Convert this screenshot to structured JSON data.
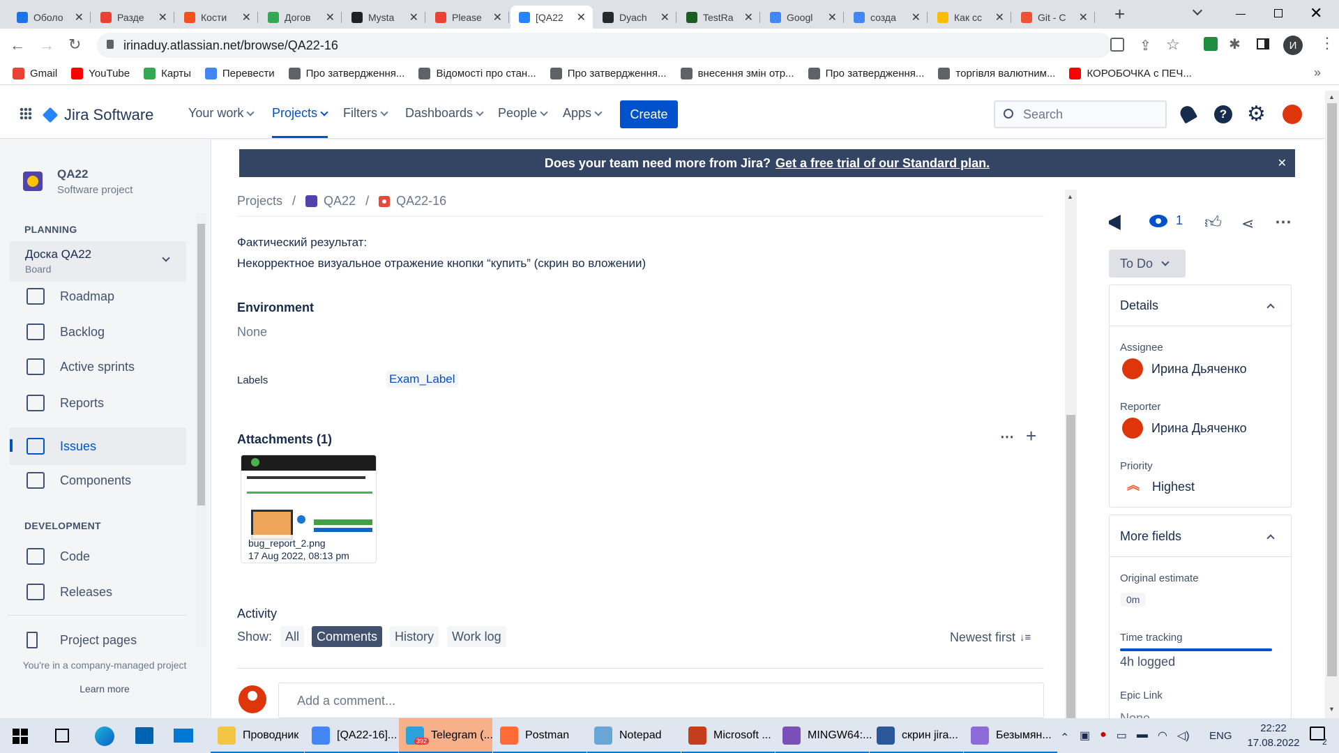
{
  "browser": {
    "tabs": [
      {
        "title": "Оболо",
        "color": "#1a73e8",
        "icon": "google-drive-icon"
      },
      {
        "title": "Разде",
        "color": "#e94235",
        "icon": "kbd-icon"
      },
      {
        "title": "Кости",
        "color": "#f4511e",
        "icon": "f-icon"
      },
      {
        "title": "Догов",
        "color": "#34a853",
        "icon": "google-drive-icon"
      },
      {
        "title": "Mysta",
        "color": "#202124",
        "icon": "graduation-cap-icon"
      },
      {
        "title": "Please",
        "color": "#ea4335",
        "icon": "gmail-icon"
      },
      {
        "title": "[QA22",
        "color": "#2684ff",
        "icon": "jira-icon"
      },
      {
        "title": "Dyach",
        "color": "#24292e",
        "icon": "github-icon"
      },
      {
        "title": "TestRa",
        "color": "#1b5e20",
        "icon": "testrail-icon"
      },
      {
        "title": "Googl",
        "color": "#4285f4",
        "icon": "google-translate-icon"
      },
      {
        "title": "созда",
        "color": "#4285f4",
        "icon": "google-icon"
      },
      {
        "title": "Как сс",
        "color": "#fbbc04",
        "icon": "bulb-icon"
      },
      {
        "title": "Git - C",
        "color": "#f05033",
        "icon": "git-icon"
      }
    ],
    "url": "irinaduy.atlassian.net/browse/QA22-16",
    "profile_initial": "И",
    "bookmarks": [
      {
        "label": "Gmail",
        "color": "#ea4335"
      },
      {
        "label": "YouTube",
        "color": "#ff0000"
      },
      {
        "label": "Карты",
        "color": "#34a853"
      },
      {
        "label": "Перевести",
        "color": "#4285f4"
      },
      {
        "label": "Про затвердження...",
        "color": "#5f6368"
      },
      {
        "label": "Відомості про стан...",
        "color": "#5f6368"
      },
      {
        "label": "Про затвердження...",
        "color": "#5f6368"
      },
      {
        "label": "внесення змін отр...",
        "color": "#5f6368"
      },
      {
        "label": "Про затвердження...",
        "color": "#5f6368"
      },
      {
        "label": "торгівля валютним...",
        "color": "#5f6368"
      },
      {
        "label": "КОРОБОЧКА с ПЕЧ...",
        "color": "#ff0000"
      }
    ]
  },
  "jira": {
    "product": "Jira Software",
    "nav": [
      "Your work",
      "Projects",
      "Filters",
      "Dashboards",
      "People",
      "Apps"
    ],
    "create": "Create",
    "search_placeholder": "Search"
  },
  "sidebar": {
    "project_name": "QA22",
    "project_type": "Software project",
    "planning": "PLANNING",
    "board_name": "Доска QA22",
    "board_sub": "Board",
    "items": [
      "Roadmap",
      "Backlog",
      "Active sprints",
      "Reports",
      "Issues",
      "Components"
    ],
    "development": "DEVELOPMENT",
    "dev_items": [
      "Code",
      "Releases"
    ],
    "project_pages": "Project pages",
    "managed_note": "You're in a company-managed project",
    "learn_more": "Learn more"
  },
  "banner": {
    "text": "Does your team need more from Jira?",
    "link": "Get a free trial of our Standard plan."
  },
  "breadcrumb": {
    "projects": "Projects",
    "project": "QA22",
    "issue": "QA22-16"
  },
  "issue": {
    "actual_label": "Фактический результат:",
    "actual_text": "Некорректное визуальное отражение кнопки “купить” (скрин во вложении)",
    "environment_label": "Environment",
    "environment_value": "None",
    "labels_label": "Labels",
    "labels_value": "Exam_Label",
    "attachments_label": "Attachments (1)",
    "attachment_name": "bug_report_2.png",
    "attachment_date": "17 Aug 2022, 08:13 pm",
    "activity_label": "Activity",
    "show_label": "Show:",
    "filters": [
      "All",
      "Comments",
      "History",
      "Work log"
    ],
    "sort": "Newest first",
    "comment_placeholder": "Add a comment..."
  },
  "right_panel": {
    "watchers": "1",
    "status": "To Do",
    "details": "Details",
    "assignee_label": "Assignee",
    "assignee": "Ирина Дьяченко",
    "reporter_label": "Reporter",
    "reporter": "Ирина Дьяченко",
    "priority_label": "Priority",
    "priority": "Highest",
    "more_fields": "More fields",
    "orig_est_label": "Original estimate",
    "orig_est": "0m",
    "time_tracking_label": "Time tracking",
    "time_tracking": "4h logged",
    "time_tracking_fraction": 1.0,
    "epic_label": "Epic Link",
    "epic_value": "None"
  },
  "taskbar": {
    "items": [
      {
        "label": "Проводник",
        "color": "#f4c542"
      },
      {
        "label": "[QA22-16]...",
        "color": "#4285f4"
      },
      {
        "label": "Telegram (...",
        "color": "#2aa1da",
        "badge": "392"
      },
      {
        "label": "Postman",
        "color": "#ff6c37"
      },
      {
        "label": "Notepad",
        "color": "#6aa5d8"
      },
      {
        "label": "Microsoft ...",
        "color": "#c43e1c"
      },
      {
        "label": "MINGW64:...",
        "color": "#7b4fb8"
      },
      {
        "label": "скрин jira...",
        "color": "#2b579a"
      },
      {
        "label": "Безымян...",
        "color": "#8c6ad9"
      }
    ],
    "lang": "ENG",
    "time": "22:22",
    "date": "17.08.2022",
    "notif_count": "2"
  }
}
